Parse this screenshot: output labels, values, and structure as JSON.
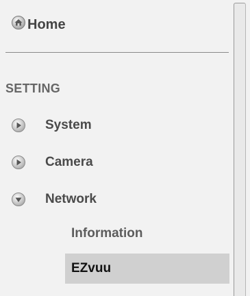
{
  "home": {
    "label": "Home",
    "icon": "home-icon"
  },
  "setting": {
    "title": "SETTING",
    "items": [
      {
        "label": "System",
        "icon": "chevron-right-icon",
        "expanded": false
      },
      {
        "label": "Camera",
        "icon": "chevron-right-icon",
        "expanded": false
      },
      {
        "label": "Network",
        "icon": "chevron-down-icon",
        "expanded": true
      }
    ],
    "network_sub_items": [
      {
        "label": "Information",
        "selected": false
      },
      {
        "label": "EZvuu",
        "selected": true
      }
    ]
  },
  "colors": {
    "background": "#f2f2f2",
    "selected_row": "#d0d0d0",
    "text": "#4a4a4a"
  }
}
